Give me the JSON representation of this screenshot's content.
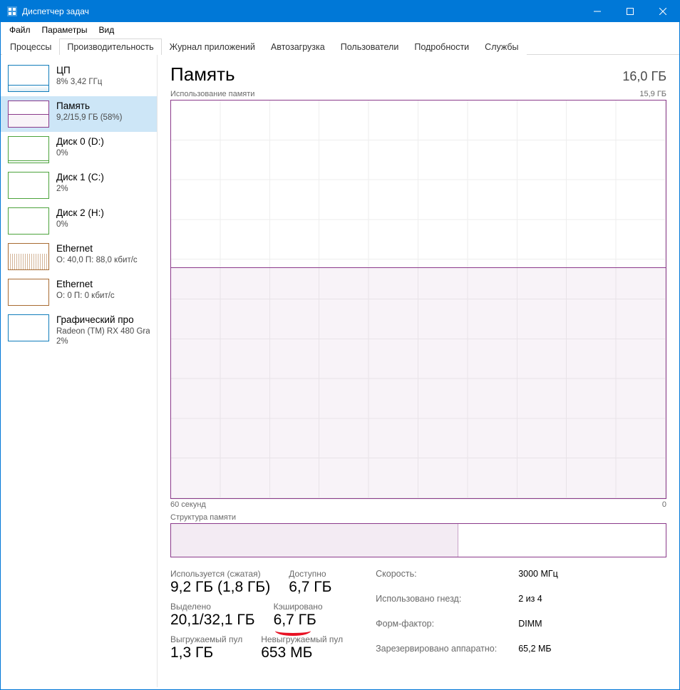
{
  "window": {
    "title": "Диспетчер задач"
  },
  "menu": {
    "file": "Файл",
    "options": "Параметры",
    "view": "Вид"
  },
  "tabs": {
    "processes": "Процессы",
    "performance": "Производительность",
    "apphistory": "Журнал приложений",
    "startup": "Автозагрузка",
    "users": "Пользователи",
    "details": "Подробности",
    "services": "Службы"
  },
  "sidebar": {
    "cpu": {
      "title": "ЦП",
      "sub": "8% 3,42 ГГц"
    },
    "mem": {
      "title": "Память",
      "sub": "9,2/15,9 ГБ (58%)"
    },
    "disk0": {
      "title": "Диск 0 (D:)",
      "sub": "0%"
    },
    "disk1": {
      "title": "Диск 1 (C:)",
      "sub": "2%"
    },
    "disk2": {
      "title": "Диск 2 (H:)",
      "sub": "0%"
    },
    "eth1": {
      "title": "Ethernet",
      "sub": "О: 40,0 П: 88,0 кбит/с"
    },
    "eth2": {
      "title": "Ethernet",
      "sub": "О: 0 П: 0 кбит/с"
    },
    "gpu": {
      "title": "Графический про",
      "sub1": "Radeon (TM) RX 480 Gra",
      "sub2": "2%"
    }
  },
  "main": {
    "title": "Память",
    "total": "16,0 ГБ",
    "chart_label": "Использование памяти",
    "chart_max": "15,9 ГБ",
    "xaxis_left": "60 секунд",
    "xaxis_right": "0",
    "comp_label": "Структура памяти",
    "stats": {
      "used_label": "Используется (сжатая)",
      "used_value": "9,2 ГБ (1,8 ГБ)",
      "avail_label": "Доступно",
      "avail_value": "6,7 ГБ",
      "commit_label": "Выделено",
      "commit_value": "20,1/32,1 ГБ",
      "cached_label": "Кэшировано",
      "cached_value": "6,7 ГБ",
      "paged_label": "Выгружаемый пул",
      "paged_value": "1,3 ГБ",
      "nonpaged_label": "Невыгружаемый пул",
      "nonpaged_value": "653 МБ"
    },
    "specs": {
      "speed_k": "Скорость:",
      "speed_v": "3000 МГц",
      "slots_k": "Использовано гнезд:",
      "slots_v": "2 из 4",
      "form_k": "Форм-фактор:",
      "form_v": "DIMM",
      "hw_k": "Зарезервировано аппаратно:",
      "hw_v": "65,2 МБ"
    }
  },
  "chart_data": {
    "type": "area",
    "title": "Использование памяти",
    "xlabel": "60 секунд → 0",
    "ylabel": "ГБ",
    "ylim": [
      0,
      15.9
    ],
    "series": [
      {
        "name": "Память",
        "values": [
          9.3,
          9.3,
          9.2,
          9.2,
          9.2,
          9.2,
          9.2,
          9.2,
          9.2,
          9.2,
          9.2
        ]
      }
    ]
  }
}
